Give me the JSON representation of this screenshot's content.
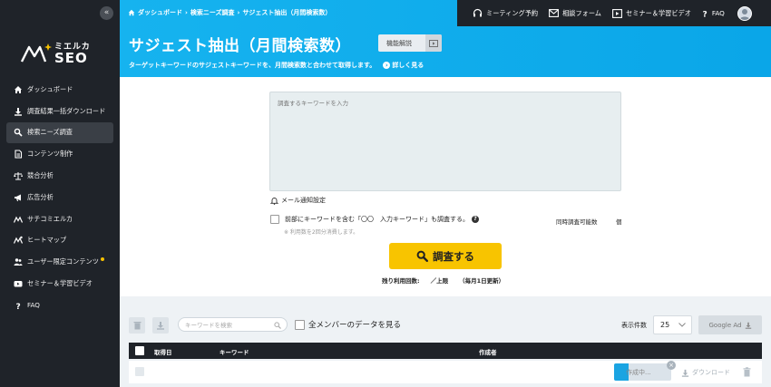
{
  "sidebar": {
    "collapse_label": "«",
    "logo_top": "ミエルカ",
    "logo_main": "SEO",
    "items": [
      {
        "label": "ダッシュボード",
        "icon": "home-icon"
      },
      {
        "label": "調査結果一括ダウンロード",
        "icon": "download-icon"
      },
      {
        "label": "検索ニーズ調査",
        "icon": "search-icon",
        "active": true
      },
      {
        "label": "コンテンツ制作",
        "icon": "document-icon"
      },
      {
        "label": "競合分析",
        "icon": "scale-icon"
      },
      {
        "label": "広告分析",
        "icon": "megaphone-icon"
      },
      {
        "label": "サチコミエルカ",
        "icon": "mieruka-icon"
      },
      {
        "label": "ヒートマップ",
        "icon": "heatmap-icon"
      },
      {
        "label": "ユーザー限定コンテンツ",
        "icon": "users-icon"
      },
      {
        "label": "セミナー＆学習ビデオ",
        "icon": "video-icon"
      },
      {
        "label": "FAQ",
        "icon": "question-icon"
      }
    ]
  },
  "breadcrumb": {
    "items": [
      "ダッシュボード",
      "検索ニーズ調査",
      "サジェスト抽出（月間検索数）"
    ],
    "separator": "›"
  },
  "topbar": {
    "meeting": "ミーティング予約",
    "contact": "相談フォーム",
    "seminar": "セミナー＆学習ビデオ",
    "faq": "FAQ"
  },
  "header": {
    "title": "サジェスト抽出（月間検索数）",
    "feature_button": "機能解説",
    "subtitle": "ターゲットキーワードのサジェストキーワードを、月間検索数と合わせて取得します。",
    "more_link": "詳しく見る"
  },
  "form": {
    "textarea_placeholder": "調査するキーワードを入力",
    "mail_setting": "メール通知設定",
    "prefix_check_label": "前部にキーワードを含む「〇〇　入力キーワード」も調査する。",
    "note": "※ 利用数を2回分消費します。",
    "concurrent_label": "同時調査可能数",
    "concurrent_unit": "個",
    "search_button": "調査する",
    "remaining_label": "残り利用回数:",
    "remaining_value": "／上限",
    "remaining_reset": "（毎月1日更新）"
  },
  "list": {
    "search_placeholder": "キーワードを検索",
    "all_members": "全メンバーのデータを見る",
    "per_page_label": "表示件数",
    "per_page_value": "25",
    "google_ads_button": "Google Ad",
    "columns": {
      "date": "取得日",
      "keyword": "キーワード",
      "creator": "作成者"
    },
    "row": {
      "status": "作成中...",
      "progress": 0.25,
      "close_mark": "×",
      "download": "ダウンロード"
    }
  },
  "colors": {
    "accent": "#0aa6e8",
    "dark": "#1f2329",
    "primary_button": "#f8c400",
    "progress": "#1aa4e2"
  }
}
